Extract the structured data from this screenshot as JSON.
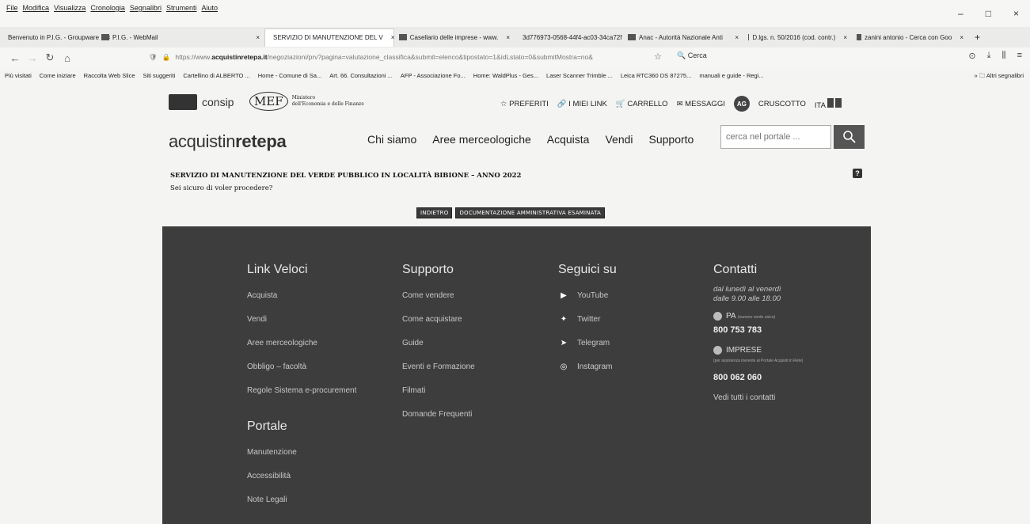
{
  "browser": {
    "menu": [
      "File",
      "Modifica",
      "Visualizza",
      "Cronologia",
      "Segnalibri",
      "Strumenti",
      "Aiuto"
    ],
    "window_controls": [
      "–",
      "□",
      "×"
    ],
    "tabs": [
      {
        "label": "Benvenuto in P.I.G. - Groupware",
        "width": 110
      },
      {
        "label": "P.I.G. - WebMail",
        "width": 200
      },
      {
        "label": "SERVIZIO DI MANUTENZIONE DEL V",
        "width": 150,
        "active": true
      },
      {
        "label": "Casellario delle imprese - www.",
        "width": 140
      },
      {
        "label": "3d776973-0568-44f4-ac03-34ca72f",
        "width": 125
      },
      {
        "label": "Anac - Autorità Nazionale Anti",
        "width": 140
      },
      {
        "label": "D.lgs. n. 50/2016 (cod. contr.)",
        "width": 125
      },
      {
        "label": "zanini antonio - Cerca con Goo",
        "width": 135
      }
    ],
    "new_tab": "+",
    "url_prefix": "https://www.",
    "url_domain": "acquistinretepa.it",
    "url_rest": "/negoziazioni/prv?pagina=valutazione_classifica&submit=elenco&tipostato=1&idLstato=0&submitMostra=no&",
    "search_placeholder": "Cerca",
    "bookmarks": [
      "Più visitati",
      "Come iniziare",
      "Raccolta Web Slice",
      "Siti suggeriti",
      "Cartellino di ALBERTO ...",
      "Home - Comune di Sa...",
      "Art. 66. Consultazioni ...",
      "AFP - Associazione Fo...",
      "Home: WaldPlus - Ges...",
      "Laser Scanner Trimble ...",
      "Leica RTC360 DS 87275...",
      "manuali e guide - Regi..."
    ],
    "bookmarks_other": "Altri segnalibri"
  },
  "header": {
    "consip": "consip",
    "mef": "MEF",
    "mef_sub1": "Ministero",
    "mef_sub2": "dell'Economia e delle Finanze",
    "links": {
      "preferiti": "PREFERITI",
      "miei_link": "I MIEI LINK",
      "carrello": "CARRELLO",
      "messaggi": "MESSAGGI",
      "avatar": "AG",
      "cruscotto": "CRUSCOTTO",
      "lang": "ITA"
    }
  },
  "brand": {
    "part1": "acquistin",
    "part2": "rete",
    "part3": "pa"
  },
  "nav": [
    "Chi siamo",
    "Aree merceologiche",
    "Acquista",
    "Vendi",
    "Supporto"
  ],
  "search": {
    "placeholder": "cerca nel portale ..."
  },
  "content": {
    "title": "SERVIZIO DI MANUTENZIONE DEL VERDE PUBBLICO IN LOCALITÀ BIBIONE – ANNO 2022",
    "question": "Sei sicuro di voler procedere?",
    "help": "?",
    "btn_back": "INDIETRO",
    "btn_doc": "DOCUMENTAZIONE AMMINISTRATIVA ESAMINATA"
  },
  "footer": {
    "link_veloci": {
      "title": "Link Veloci",
      "items": [
        "Acquista",
        "Vendi",
        "Aree merceologiche",
        "Obbligo – facoltà",
        "Regole Sistema e-procurement"
      ]
    },
    "portale": {
      "title": "Portale",
      "items": [
        "Manutenzione",
        "Accessibilità",
        "Note Legali"
      ]
    },
    "supporto": {
      "title": "Supporto",
      "items": [
        "Come vendere",
        "Come acquistare",
        "Guide",
        "Eventi e Formazione",
        "Filmati",
        "Domande Frequenti"
      ]
    },
    "seguici": {
      "title": "Seguici su",
      "items": [
        {
          "label": "YouTube",
          "icon": "youtube-icon",
          "glyph": "▶"
        },
        {
          "label": "Twitter",
          "icon": "twitter-icon",
          "glyph": "✦"
        },
        {
          "label": "Telegram",
          "icon": "telegram-icon",
          "glyph": "➤"
        },
        {
          "label": "Instagram",
          "icon": "instagram-icon",
          "glyph": "◎"
        }
      ]
    },
    "contatti": {
      "title": "Contatti",
      "hours1": "dal lunedì al venerdì",
      "hours2": "dalle 9.00 alle 18.00",
      "pa_label": "PA",
      "pa_note": "(numero verde unico)",
      "pa_phone": "800 753 783",
      "imprese_label": "IMPRESE",
      "imprese_note": "(per assistenza inerente al Portale Acquisti in Rete)",
      "imprese_phone": "800 062 060",
      "all_contacts": "Vedi tutti i contatti"
    }
  },
  "colors": {
    "footer_bg": "#3d3d3d",
    "button_bg": "#3a3a3a",
    "search_btn": "#555555"
  }
}
